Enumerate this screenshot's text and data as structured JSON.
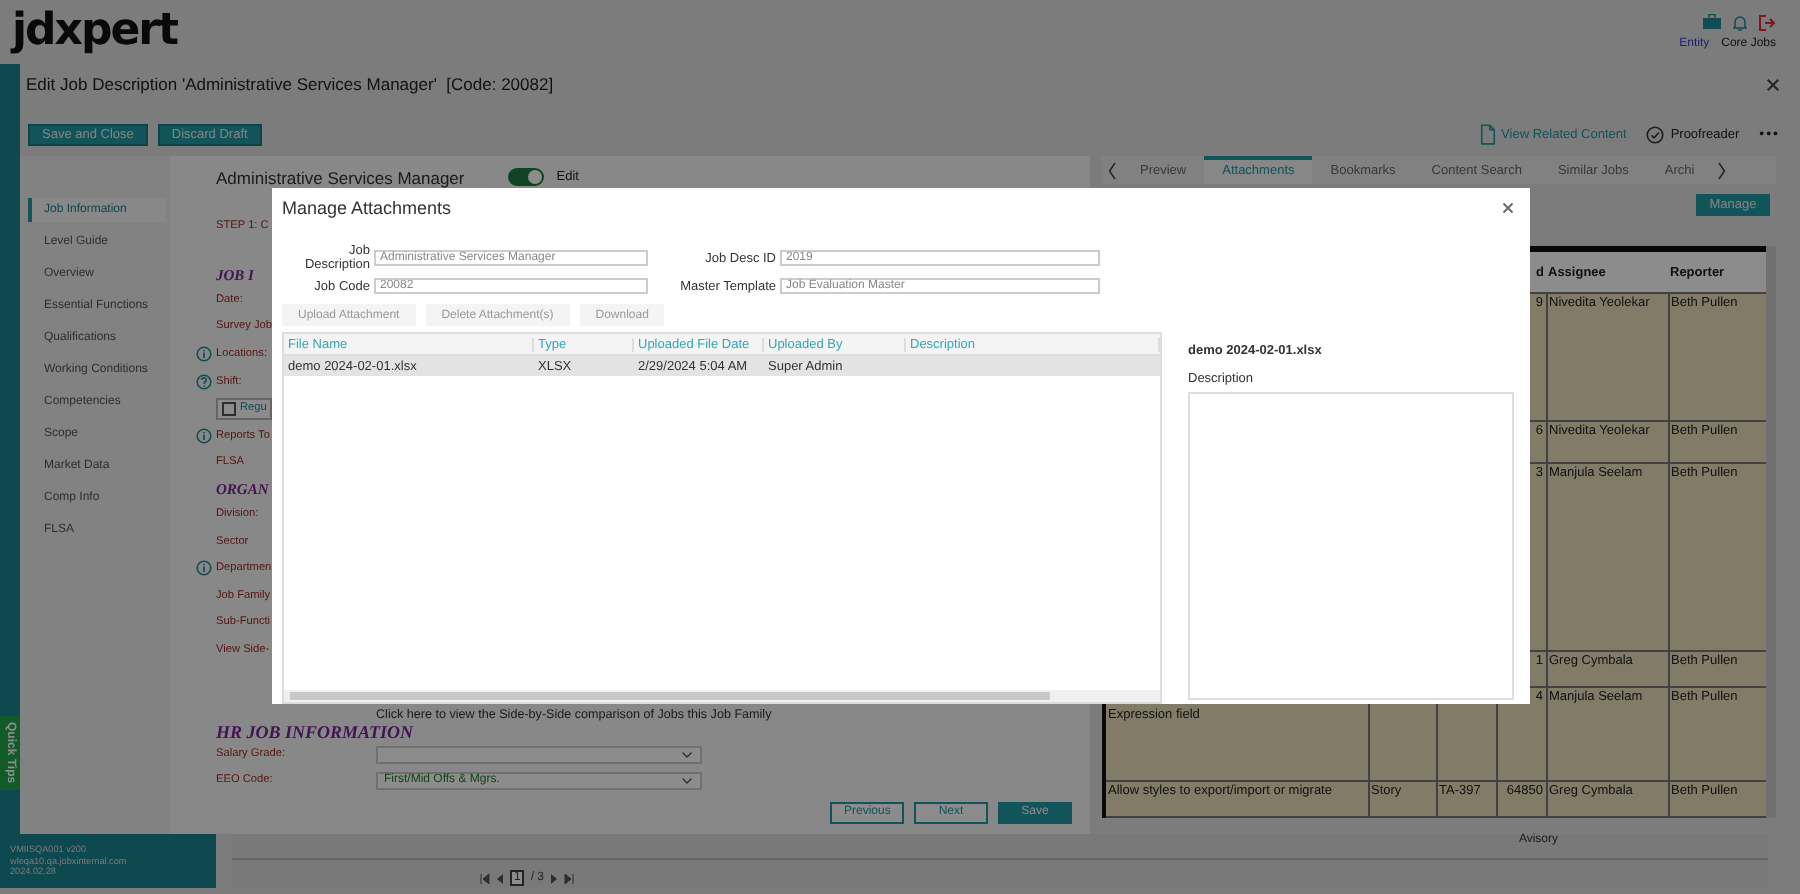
{
  "header": {
    "logo": "jdxpert",
    "entity_link": "Entity",
    "app_name": "Core Jobs"
  },
  "page_title": "Edit Job Description 'Administrative Services Manager'  [Code: 20082]",
  "toolbar": {
    "buttons": [
      "Save and Close",
      "Discard Draft"
    ],
    "links": [
      {
        "label": "View Related Content",
        "kind": "document"
      },
      {
        "label": "Proofreader",
        "kind": "check"
      }
    ],
    "more": "•••"
  },
  "nav": [
    {
      "label": "Job Information",
      "selected": true
    },
    {
      "label": "Level Guide",
      "selected": false
    },
    {
      "label": "Overview",
      "selected": false
    },
    {
      "label": "Essential Functions",
      "selected": false
    },
    {
      "label": "Qualifications",
      "selected": false
    },
    {
      "label": "Working Conditions",
      "selected": false
    },
    {
      "label": "Competencies",
      "selected": false
    },
    {
      "label": "Scope",
      "selected": false
    },
    {
      "label": "Market Data",
      "selected": false
    },
    {
      "label": "Comp Info",
      "selected": false
    },
    {
      "label": "FLSA",
      "selected": false
    }
  ],
  "form": {
    "job_title": "Administrative Services Manager",
    "edit_toggle": {
      "label": "Edit",
      "on": true
    },
    "rows": [
      {
        "kind": "step",
        "text": "STEP 1: C"
      },
      {
        "kind": "heading",
        "text": "JOB I"
      },
      {
        "kind": "label",
        "text": "Date:"
      },
      {
        "kind": "label",
        "text": "Survey Job"
      },
      {
        "kind": "info",
        "text": "Locations:"
      },
      {
        "kind": "help",
        "text": "Shift:"
      },
      {
        "kind": "checkbox",
        "text": "Regu",
        "checked": false
      },
      {
        "kind": "info",
        "text": "Reports To"
      },
      {
        "kind": "label",
        "text": "FLSA"
      },
      {
        "kind": "heading",
        "text": "ORGAN"
      },
      {
        "kind": "label",
        "text": "Division:"
      },
      {
        "kind": "label",
        "text": "Sector"
      },
      {
        "kind": "info",
        "text": "Departmen"
      },
      {
        "kind": "label",
        "text": "Job Family"
      },
      {
        "kind": "label",
        "text": "Sub-Functi"
      },
      {
        "kind": "label",
        "text": "View Side-"
      }
    ],
    "side_by_side_link": "Click here to view the Side-by-Side comparison of Jobs this Job Family",
    "hr_heading": "HR JOB INFORMATION",
    "fields": [
      {
        "label": "Salary Grade:"
      },
      {
        "label": "EEO Code:",
        "value": "First/Mid Offs & Mgrs."
      }
    ],
    "buttons": [
      {
        "label": "Previous",
        "kind": "secondary"
      },
      {
        "label": "Next",
        "kind": "secondary"
      },
      {
        "label": "Save",
        "kind": "primary"
      }
    ]
  },
  "side_panel": {
    "tabs": [
      {
        "label": "Preview",
        "selected": false
      },
      {
        "label": "Attachments",
        "selected": true
      },
      {
        "label": "Bookmarks",
        "selected": false
      },
      {
        "label": "Content Search",
        "selected": false
      },
      {
        "label": "Similar Jobs",
        "selected": false
      },
      {
        "label": "Archi",
        "selected": false
      }
    ],
    "manage_button": "Manage",
    "table": {
      "header": {
        "number": "d",
        "assignee": "Assignee",
        "reporter": "Reporter"
      },
      "rows": [
        {
          "number": "9",
          "assignee": "Nivedita Yeolekar",
          "reporter": "Beth Pullen"
        },
        {
          "number": "6",
          "assignee": "Nivedita Yeolekar",
          "reporter": "Beth Pullen"
        },
        {
          "number": "3",
          "assignee": "Manjula Seelam",
          "reporter": "Beth Pullen"
        },
        {
          "number": "1",
          "assignee": "Greg Cymbala",
          "reporter": "Beth Pullen"
        },
        {
          "summary": "Expression field",
          "number": "4",
          "assignee": "Manjula Seelam",
          "reporter": "Beth Pullen"
        },
        {
          "summary": "Allow styles to export/import or migrate",
          "type": "Story",
          "key": "TA-397",
          "number": "64850",
          "assignee": "Greg Cymbala",
          "reporter": "Beth Pullen"
        }
      ]
    }
  },
  "bottom_grid": {
    "cell": "Avisory",
    "pager": {
      "current": "1",
      "total": "/ 3"
    }
  },
  "footer": {
    "lines": [
      "VMIISQA001 v200",
      "wleqa10.qa.jobxinternal.com",
      "2024.02.28"
    ]
  },
  "quick_tips": "Quick Tips",
  "modal": {
    "title": "Manage Attachments",
    "fields": [
      {
        "label": "Job Description",
        "value": "Administrative Services Manager"
      },
      {
        "label": "Job Desc ID",
        "value": "2019"
      },
      {
        "label": "Job Code",
        "value": "20082"
      },
      {
        "label": "Master Template",
        "value": "Job Evaluation Master"
      }
    ],
    "actions": [
      {
        "label": "Upload Attachment",
        "disabled": true
      },
      {
        "label": "Delete Attachment(s)",
        "disabled": true
      },
      {
        "label": "Download",
        "disabled": true
      }
    ],
    "grid": {
      "columns": [
        "File Name",
        "Type",
        "Uploaded File Date",
        "Uploaded By",
        "Description"
      ],
      "rows": [
        {
          "cells": [
            "demo 2024-02-01.xlsx",
            "XLSX",
            "2/29/2024 5:04 AM",
            "Super Admin"
          ],
          "selected": true
        }
      ]
    },
    "detail": {
      "file_name": "demo 2024-02-01.xlsx",
      "description_label": "Description"
    }
  }
}
